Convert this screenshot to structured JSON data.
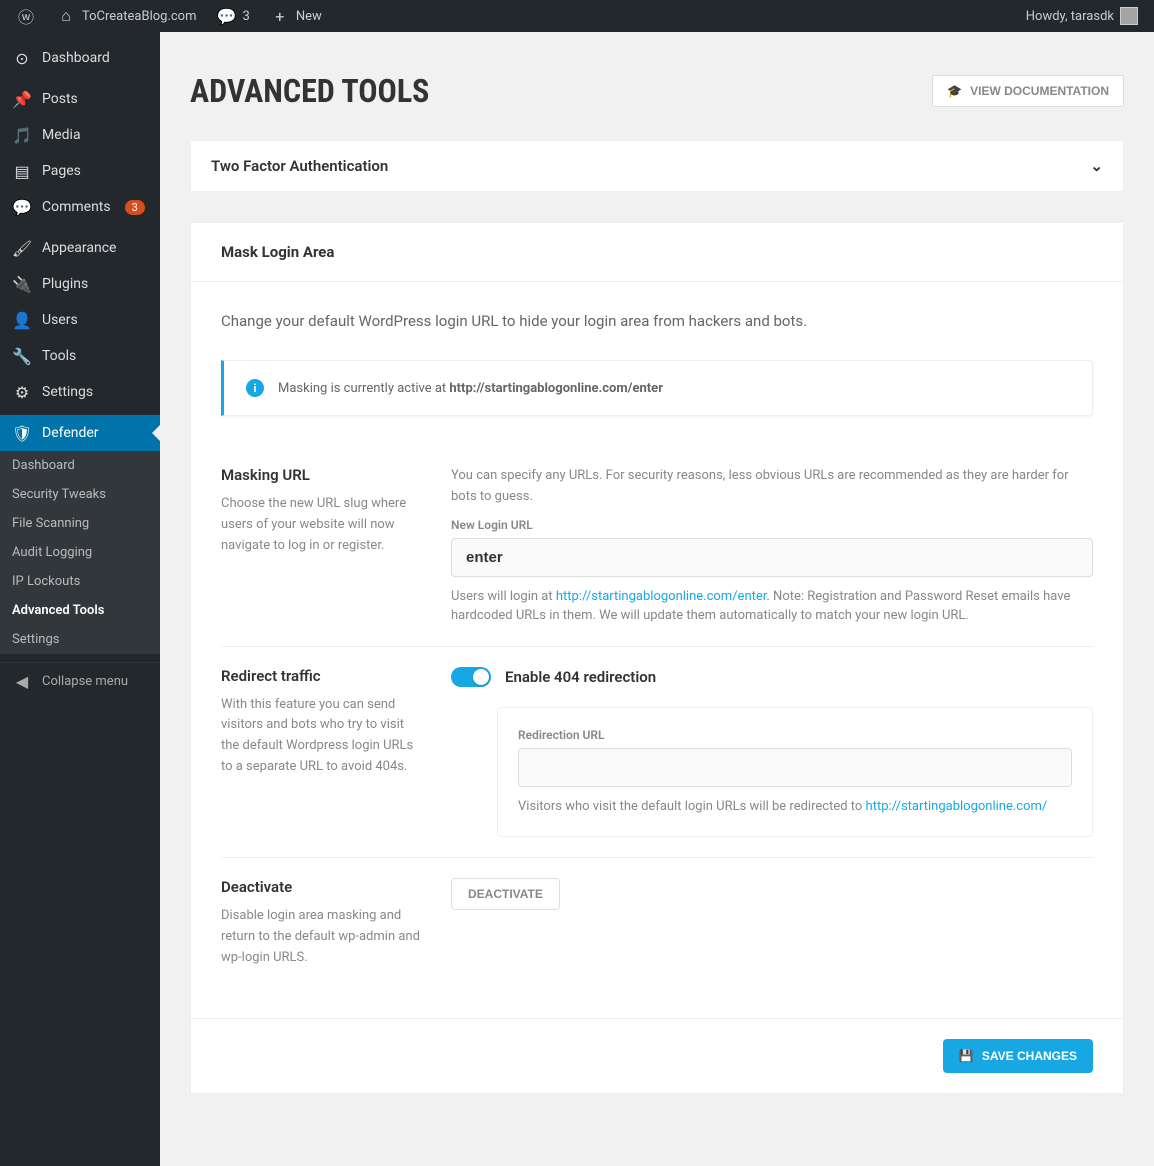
{
  "topbar": {
    "site_name": "ToCreateaBlog.com",
    "comments_count": "3",
    "new_label": "New",
    "howdy": "Howdy, tarasdk"
  },
  "sidebar": {
    "items": [
      {
        "label": "Dashboard",
        "icon": "dashboard"
      },
      {
        "label": "Posts",
        "icon": "pin"
      },
      {
        "label": "Media",
        "icon": "media"
      },
      {
        "label": "Pages",
        "icon": "page"
      },
      {
        "label": "Comments",
        "icon": "comment",
        "badge": "3"
      },
      {
        "label": "Appearance",
        "icon": "brush"
      },
      {
        "label": "Plugins",
        "icon": "plugin"
      },
      {
        "label": "Users",
        "icon": "user"
      },
      {
        "label": "Tools",
        "icon": "wrench"
      },
      {
        "label": "Settings",
        "icon": "settings"
      },
      {
        "label": "Defender",
        "icon": "shield",
        "active": true
      }
    ],
    "submenu": [
      {
        "label": "Dashboard"
      },
      {
        "label": "Security Tweaks"
      },
      {
        "label": "File Scanning"
      },
      {
        "label": "Audit Logging"
      },
      {
        "label": "IP Lockouts"
      },
      {
        "label": "Advanced Tools",
        "active": true
      },
      {
        "label": "Settings"
      }
    ],
    "collapse": "Collapse menu"
  },
  "page": {
    "title": "ADVANCED TOOLS",
    "doc_btn": "VIEW DOCUMENTATION"
  },
  "accordion": {
    "title": "Two Factor Authentication"
  },
  "mask": {
    "header": "Mask Login Area",
    "desc": "Change your default WordPress login URL to hide your login area from hackers and bots.",
    "notice_prefix": "Masking is currently active at ",
    "notice_url": "http://startingablogonline.com/enter",
    "url_section": {
      "title": "Masking URL",
      "desc": "Choose the new URL slug where users of your website will now navigate to log in or register.",
      "right_desc": "You can specify any URLs. For security reasons, less obvious URLs are recommended as they are harder for bots to guess.",
      "label": "New Login URL",
      "value": "enter",
      "help_prefix": "Users will login at ",
      "help_link": "http://startingablogonline.com/enter",
      "help_suffix": ". Note: Registration and Password Reset emails have hardcoded URLs in them. We will update them automatically to match your new login URL."
    },
    "redirect": {
      "title": "Redirect traffic",
      "desc": "With this feature you can send visitors and bots who try to visit the default Wordpress login URLs to a separate URL to avoid 404s.",
      "toggle_label": "Enable 404 redirection",
      "sub_label": "Redirection URL",
      "sub_value": "",
      "sub_help_prefix": "Visitors who visit the default login URLs will be redirected to ",
      "sub_help_link": "http://startingablogonline.com/"
    },
    "deactivate": {
      "title": "Deactivate",
      "desc": "Disable login area masking and return to the default wp-admin and wp-login URLS.",
      "btn": "DEACTIVATE"
    },
    "save_btn": "SAVE CHANGES"
  }
}
